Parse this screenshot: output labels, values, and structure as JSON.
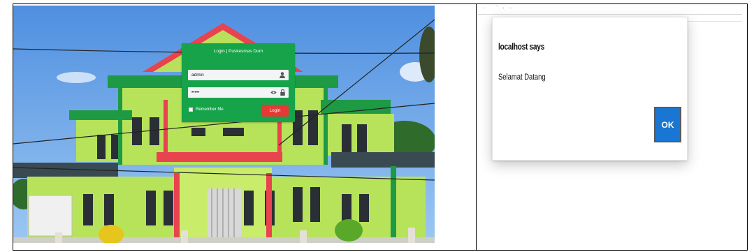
{
  "login_page": {
    "title": "Login | Puskesmas Dum",
    "username_value": "admin",
    "password_value": "•••••",
    "remember_label": "Remember Me",
    "login_button": "Login",
    "colors": {
      "panel": "#16a34a",
      "button": "#e53935"
    },
    "icons": [
      "user-icon",
      "eye-icon",
      "lock-icon"
    ]
  },
  "alert": {
    "title": "localhost says",
    "message": "Selamat Datang",
    "ok_button": "OK",
    "colors": {
      "button": "#1976d2"
    }
  }
}
